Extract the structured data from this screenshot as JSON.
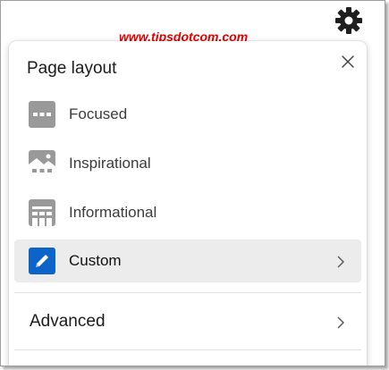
{
  "watermark": "www.tipsdotcom.com",
  "icons": {
    "settings": "gear-icon",
    "close": "close-icon",
    "chevron": "chevron-right-icon"
  },
  "panel": {
    "title": "Page layout",
    "options": [
      {
        "label": "Focused",
        "icon": "focused-layout-icon",
        "selected": false
      },
      {
        "label": "Inspirational",
        "icon": "inspirational-layout-icon",
        "selected": false
      },
      {
        "label": "Informational",
        "icon": "informational-layout-icon",
        "selected": false
      },
      {
        "label": "Custom",
        "icon": "pencil-icon",
        "selected": true
      }
    ],
    "advanced_label": "Advanced"
  },
  "colors": {
    "icon_gray": "#999999",
    "custom_icon_blue": "#0c64c8",
    "selected_row": "#ececec",
    "watermark_red": "#e30000"
  }
}
